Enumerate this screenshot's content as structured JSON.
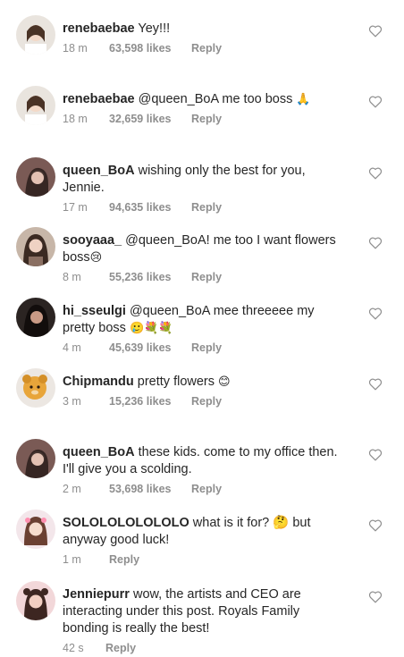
{
  "comments": [
    {
      "username": "renebaebae",
      "text": "Yey!!!",
      "emoji": "",
      "time": "18 m",
      "likes": "63,598 likes",
      "reply": "Reply"
    },
    {
      "username": "renebaebae",
      "text": "@queen_BoA me too boss",
      "emoji": "🙏",
      "time": "18 m",
      "likes": "32,659 likes",
      "reply": "Reply"
    },
    {
      "username": "queen_BoA",
      "text": "wishing only the best for you, Jennie.",
      "emoji": "",
      "time": "17 m",
      "likes": "94,635 likes",
      "reply": "Reply"
    },
    {
      "username": "sooyaaa_",
      "text": "@queen_BoA! me too I want flowers boss",
      "emoji": "😢",
      "time": "8 m",
      "likes": "55,236 likes",
      "reply": "Reply"
    },
    {
      "username": "hi_sseulgi",
      "text": "@queen_BoA mee threeeee my pretty boss",
      "emoji": "🥲💐💐",
      "time": "4 m",
      "likes": "45,639 likes",
      "reply": "Reply"
    },
    {
      "username": "Chipmandu",
      "text": "pretty flowers",
      "emoji": "😊",
      "time": "3 m",
      "likes": "15,236 likes",
      "reply": "Reply"
    },
    {
      "username": "queen_BoA",
      "text": "these kids. come to my office then. I'll give you a scolding.",
      "emoji": "",
      "time": "2 m",
      "likes": "53,698 likes",
      "reply": "Reply"
    },
    {
      "username": "SOLOLOLOLOLOLO",
      "text": "what is it for? 🤔 but anyway good luck!",
      "emoji": "",
      "time": "1 m",
      "likes": "",
      "reply": "Reply"
    },
    {
      "username": "Jenniepurr",
      "text": "wow, the artists and CEO are interacting under this post. Royals Family bonding is really the best!",
      "emoji": "",
      "time": "42 s",
      "likes": "",
      "reply": "Reply"
    }
  ],
  "icons": {
    "like": "heart-outline-icon"
  },
  "colors": {
    "text": "#262626",
    "meta": "#8e8e8e"
  }
}
